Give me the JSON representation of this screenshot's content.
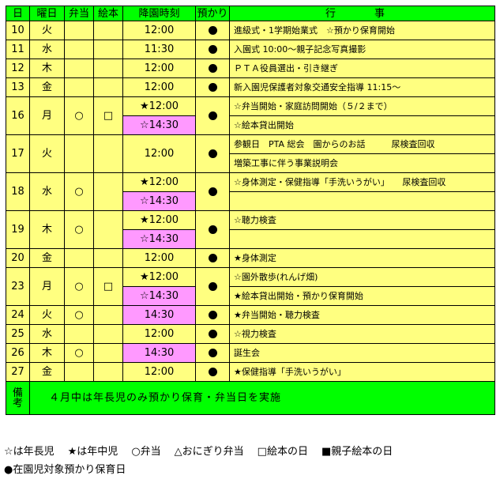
{
  "colors": {
    "cell": "#ffff80",
    "header": "#00ff00",
    "pickup_alt": "#ff99ff"
  },
  "icons": {
    "boxed_lunch": "circle",
    "picture_book": "square",
    "childcare": "filled-circle"
  },
  "header": {
    "day": "日",
    "weekday": "曜日",
    "lunch": "弁当",
    "book": "絵本",
    "pickup": "降園時刻",
    "childcare": "預かり",
    "events": "行　事"
  },
  "rows": [
    {
      "day": "10",
      "weekday": "火",
      "lunch": "",
      "book": "",
      "times": [
        "12:00"
      ],
      "childcare": "●",
      "events": [
        "進級式・1学期始業式　☆預かり保育開始"
      ]
    },
    {
      "day": "11",
      "weekday": "水",
      "lunch": "",
      "book": "",
      "times": [
        "11:30"
      ],
      "childcare": "●",
      "events": [
        "入園式 10:00～親子記念写真撮影"
      ]
    },
    {
      "day": "12",
      "weekday": "木",
      "lunch": "",
      "book": "",
      "times": [
        "12:00"
      ],
      "childcare": "●",
      "events": [
        "ＰＴＡ役員選出・引き継ぎ"
      ]
    },
    {
      "day": "13",
      "weekday": "金",
      "lunch": "",
      "book": "",
      "times": [
        "12:00"
      ],
      "childcare": "●",
      "events": [
        "新入園児保護者対象交通安全指導 11:15～"
      ]
    },
    {
      "day": "16",
      "weekday": "月",
      "lunch": "○",
      "book": "□",
      "times": [
        "★12:00",
        "☆14:30"
      ],
      "childcare": "●",
      "events": [
        "☆弁当開始・家庭訪問開始（５/２まで）",
        "☆絵本貸出開始"
      ]
    },
    {
      "day": "17",
      "weekday": "火",
      "lunch": "",
      "book": "",
      "times": [
        "12:00"
      ],
      "childcare": "●",
      "events": [
        "参観日　PTA 総会　園からのお話　　　尿検査回収",
        "増築工事に伴う事業説明会"
      ]
    },
    {
      "day": "18",
      "weekday": "水",
      "lunch": "○",
      "book": "",
      "times": [
        "★12:00",
        "☆14:30"
      ],
      "childcare": "●",
      "events": [
        "☆身体測定・保健指導「手洗いうがい」　　尿検査回収",
        ""
      ]
    },
    {
      "day": "19",
      "weekday": "木",
      "lunch": "○",
      "book": "",
      "times": [
        "★12:00",
        "☆14:30"
      ],
      "childcare": "●",
      "events": [
        "☆聴力検査",
        ""
      ]
    },
    {
      "day": "20",
      "weekday": "金",
      "lunch": "",
      "book": "",
      "times": [
        "12:00"
      ],
      "childcare": "●",
      "events": [
        "★身体測定"
      ]
    },
    {
      "day": "23",
      "weekday": "月",
      "lunch": "○",
      "book": "□",
      "times": [
        "★12:00",
        "☆14:30"
      ],
      "childcare": "●",
      "events": [
        "☆園外散歩(れんげ畑)",
        "★絵本貸出開始・預かり保育開始"
      ]
    },
    {
      "day": "24",
      "weekday": "火",
      "lunch": "○",
      "book": "",
      "times": [
        "14:30"
      ],
      "childcare": "●",
      "events": [
        "★弁当開始・聴力検査"
      ]
    },
    {
      "day": "25",
      "weekday": "水",
      "lunch": "",
      "book": "",
      "times": [
        "12:00"
      ],
      "childcare": "●",
      "events": [
        "☆視力検査"
      ]
    },
    {
      "day": "26",
      "weekday": "木",
      "lunch": "○",
      "book": "",
      "times": [
        "14:30"
      ],
      "childcare": "●",
      "events": [
        "誕生会"
      ]
    },
    {
      "day": "27",
      "weekday": "金",
      "lunch": "",
      "book": "",
      "times": [
        "12:00"
      ],
      "childcare": "●",
      "events": [
        "★保健指導「手洗いうがい」"
      ]
    }
  ],
  "note": {
    "label_1": "備",
    "label_2": "考",
    "text": "４月中は年長児のみ預かり保育・弁当日を実施"
  },
  "legend": {
    "line1": [
      "☆は年長児",
      "★は年中児",
      "○弁当",
      "△おにぎり弁当",
      "□絵本の日",
      "■親子絵本の日"
    ],
    "line2": "●在園児対象預かり保育日"
  }
}
